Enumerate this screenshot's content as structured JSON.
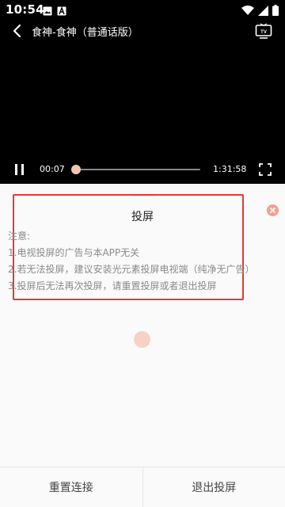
{
  "status_bar": {
    "time": "10:54",
    "left_icons": [
      "image-icon",
      "a-badge-icon"
    ],
    "right_icons": [
      "wifi-icon",
      "signal-icon",
      "battery-icon"
    ]
  },
  "video": {
    "title": "食神-食神（普通话版）",
    "current_time": "00:07",
    "total_time": "1:31:58",
    "progress_fraction": 0.001
  },
  "panel": {
    "title": "投屏",
    "notes_header": "注意:",
    "notes": [
      "1.电视投屏的广告与本APP无关",
      "2.若无法投屏，建议安装光元素投屏电视端（纯净无广告）",
      "3.投屏后无法再次投屏，请重置投屏或者退出投屏"
    ]
  },
  "footer": {
    "reset_label": "重置连接",
    "exit_label": "退出投屏"
  },
  "colors": {
    "accent": "#f0c6b3",
    "highlight": "#e53935",
    "close": "#f2a08d"
  }
}
